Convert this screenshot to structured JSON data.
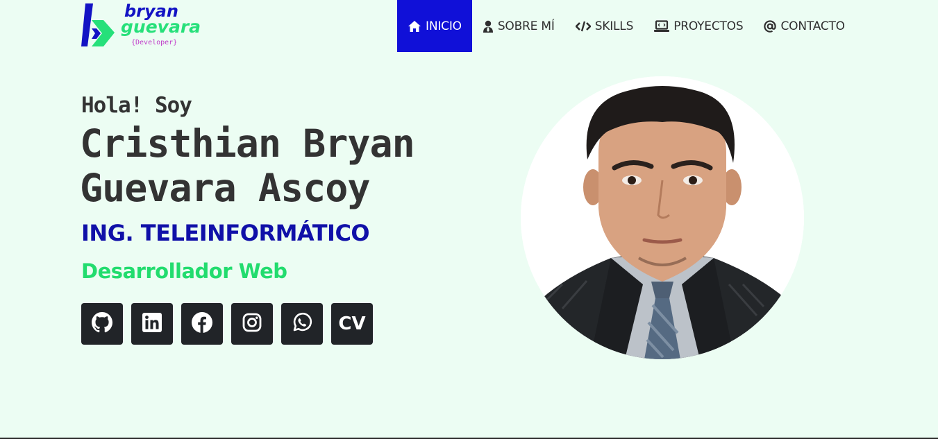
{
  "logo": {
    "word1": "bryan",
    "word2": "guevara",
    "sub": "{Developer}",
    "icon": "b-chevron-logo",
    "colors": {
      "primary": "#1313c4",
      "accent": "#26e07a",
      "sub": "#c03ac9"
    }
  },
  "nav": {
    "items": [
      {
        "label": "INICIO",
        "icon": "home-icon",
        "active": true
      },
      {
        "label": "SOBRE MÍ",
        "icon": "user-tie-icon",
        "active": false
      },
      {
        "label": "SKILLS",
        "icon": "code-icon",
        "active": false
      },
      {
        "label": "PROYECTOS",
        "icon": "laptop-code-icon",
        "active": false
      },
      {
        "label": "CONTACTO",
        "icon": "at-icon",
        "active": false
      }
    ],
    "active_color": "#1010d8"
  },
  "hero": {
    "greeting": "Hola! Soy",
    "name_line1": "Cristhian Bryan",
    "name_line2": "Guevara Ascoy",
    "title": "ING. TELEINFORMÁTICO",
    "subtitle": "Desarrollador Web",
    "title_color": "#1010a8",
    "subtitle_color": "#22dc6e"
  },
  "socials": [
    {
      "icon": "github-icon"
    },
    {
      "icon": "linkedin-icon"
    },
    {
      "icon": "facebook-icon"
    },
    {
      "icon": "instagram-icon"
    },
    {
      "icon": "whatsapp-icon"
    },
    {
      "icon": "cv-text",
      "label": "CV"
    }
  ],
  "photo": {
    "icon": "profile-photo"
  },
  "page": {
    "background": "#ecfdf3"
  }
}
